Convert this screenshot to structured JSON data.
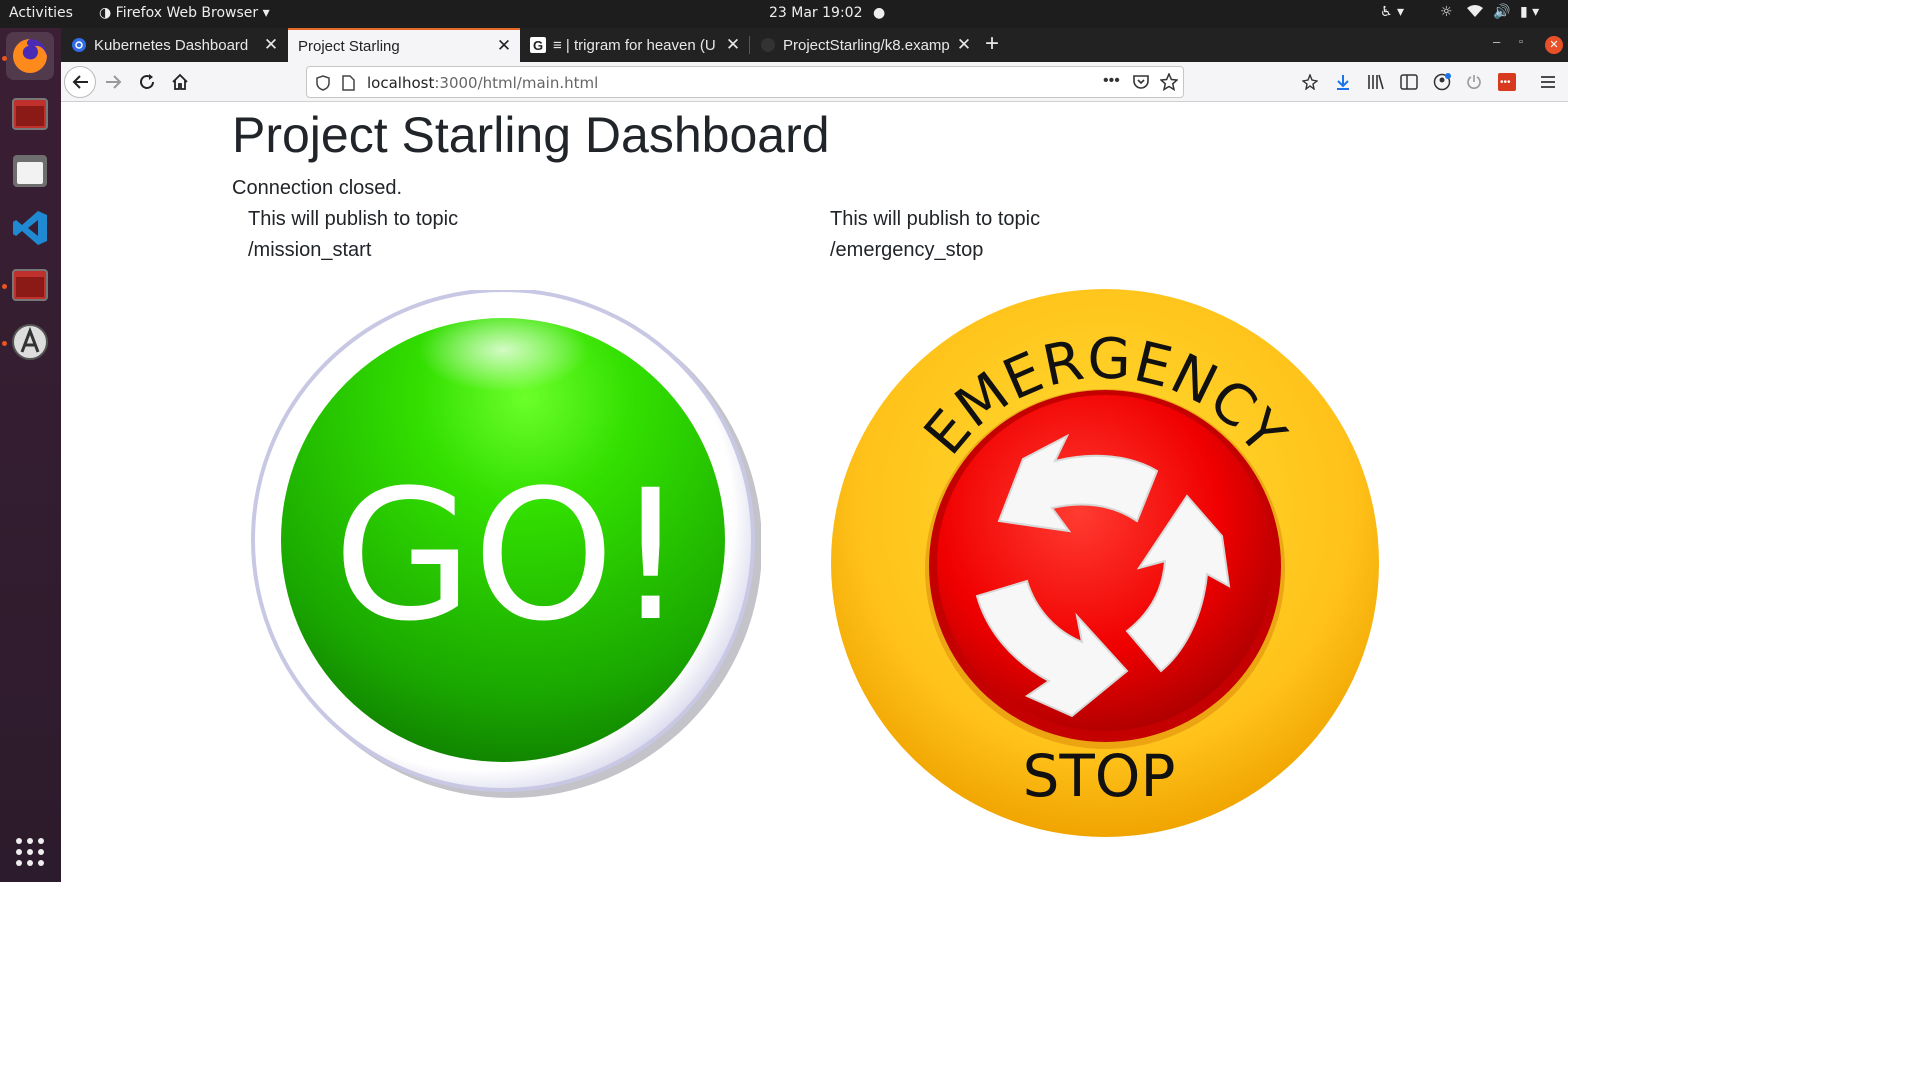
{
  "system_bar": {
    "activities": "Activities",
    "app_menu": "Firefox Web Browser",
    "clock": "23 Mar  19:02"
  },
  "browser": {
    "tabs": [
      {
        "label": "Kubernetes Dashboard",
        "active": false,
        "favicon": "kubernetes-icon"
      },
      {
        "label": "Project Starling",
        "active": true,
        "favicon": "none"
      },
      {
        "label": "≡ | trigram for heaven (U",
        "active": false,
        "favicon": "google-g-icon"
      },
      {
        "label": "ProjectStarling/k8.examp",
        "active": false,
        "favicon": "github-icon"
      }
    ],
    "url_host": "localhost",
    "url_rest": ":3000/html/main.html"
  },
  "page": {
    "title": "Project Starling Dashboard",
    "status": "Connection closed.",
    "go": {
      "line1": "This will publish to topic",
      "line2": "/mission_start",
      "button_text": "GO!"
    },
    "stop": {
      "line1": "This will publish to topic",
      "line2": "/emergency_stop",
      "top_text": "EMERGENCY",
      "bottom_text": "STOP"
    }
  },
  "colors": {
    "accent_tab": "#e66a28",
    "go_green": "#1fbf00",
    "stop_red": "#e40000",
    "stop_yellow": "#f7b500"
  }
}
